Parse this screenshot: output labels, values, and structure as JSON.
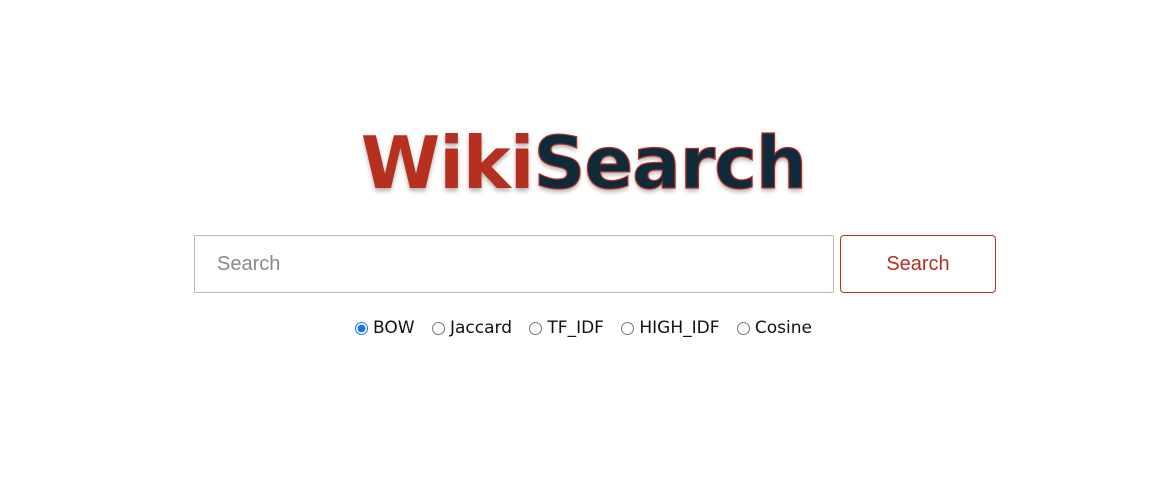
{
  "logo": {
    "part1": "Wiki",
    "part2": "Search",
    "colors": {
      "wiki": "#b5301e",
      "search": "#0f2a3a"
    }
  },
  "search": {
    "placeholder": "Search",
    "value": "",
    "button_label": "Search",
    "accent_color": "#b5301e"
  },
  "options": {
    "selected": "BOW",
    "items": [
      {
        "label": "BOW",
        "checked": true
      },
      {
        "label": "Jaccard",
        "checked": false
      },
      {
        "label": "TF_IDF",
        "checked": false
      },
      {
        "label": "HIGH_IDF",
        "checked": false
      },
      {
        "label": "Cosine",
        "checked": false
      }
    ]
  }
}
